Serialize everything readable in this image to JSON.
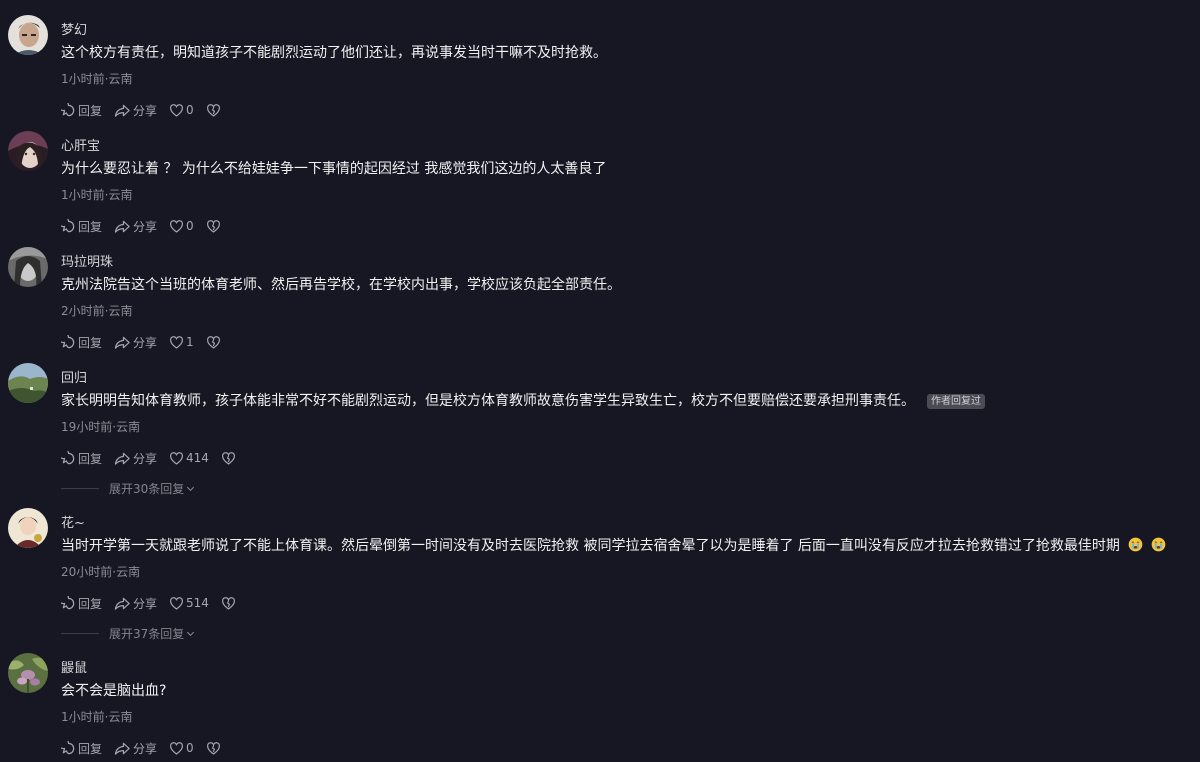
{
  "labels": {
    "reply": "回复",
    "share": "分享"
  },
  "colors": {
    "background": "#161722",
    "primary_text": "#f1f1f3",
    "secondary_text": "#8b8c95",
    "author_tag_bg": "#4a4b55"
  },
  "comments": [
    {
      "username": "梦幻",
      "text": "这个校方有责任，明知道孩子不能剧烈运动了他们还让，再说事发当时干嘛不及时抢救。",
      "meta": "1小时前·云南",
      "likes": "0",
      "avatar_colors": [
        "#c9b8a8",
        "#5a4a3c"
      ]
    },
    {
      "username": "心肝宝",
      "text": "为什么要忍让着 ？ 为什么不给娃娃争一下事情的起因经过  我感觉我们这边的人太善良了",
      "meta": "1小时前·云南",
      "likes": "0",
      "avatar_colors": [
        "#6b3e55",
        "#d8c3b8"
      ]
    },
    {
      "username": "玛拉明珠",
      "text": "克州法院告这个当班的体育老师、然后再告学校，在学校内出事，学校应该负起全部责任。",
      "meta": "2小时前·云南",
      "likes": "1",
      "avatar_colors": [
        "#7d7d7d",
        "#3a3a3a"
      ]
    },
    {
      "username": "回归",
      "text": "家长明明告知体育教师，孩子体能非常不好不能剧烈运动，但是校方体育教师故意伤害学生异致生亡，校方不但要赔偿还要承担刑事责任。",
      "author_tag": "作者回复过",
      "meta": "19小时前·云南",
      "likes": "414",
      "avatar_colors": [
        "#8fa9c0",
        "#4d6a3a"
      ],
      "expand_label": "展开30条回复"
    },
    {
      "username": "花~",
      "text": "当时开学第一天就跟老师说了不能上体育课。然后晕倒第一时间没有及时去医院抢救  被同学拉去宿舍晕了以为是睡着了 后面一直叫没有反应才拉去抢救错过了抢救最佳时期",
      "emojis": [
        "crying-face",
        "crying-face"
      ],
      "meta": "20小时前·云南",
      "likes": "514",
      "avatar_colors": [
        "#e8dcc8",
        "#2b2420"
      ],
      "expand_label": "展开37条回复"
    },
    {
      "username": "鼹鼠",
      "text": "会不会是脑出血?",
      "meta": "1小时前·云南",
      "likes": "0",
      "avatar_colors": [
        "#6e8a4e",
        "#b58fb0"
      ]
    }
  ]
}
